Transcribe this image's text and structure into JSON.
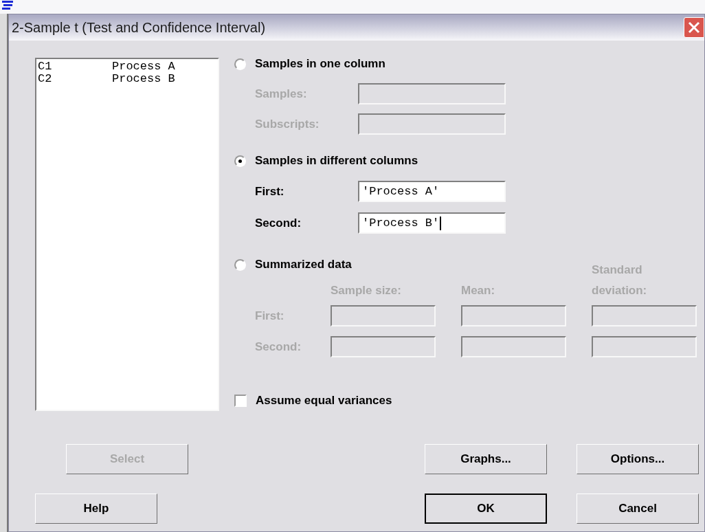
{
  "window": {
    "title": "2-Sample t (Test and Confidence Interval)"
  },
  "variables": [
    {
      "column": "C1",
      "name": "Process A"
    },
    {
      "column": "C2",
      "name": "Process B"
    }
  ],
  "modes": [
    {
      "kind": "fields",
      "label": "Samples in one column",
      "selected": false,
      "fields": [
        {
          "label": "Samples:",
          "disabled": true,
          "focused": false
        },
        {
          "label": "Subscripts:",
          "disabled": true,
          "focused": false
        }
      ]
    },
    {
      "kind": "fields",
      "label": "Samples in different columns",
      "selected": true,
      "fields": [
        {
          "label": "First:",
          "value": "'Process A'",
          "disabled": false,
          "focused": false
        },
        {
          "label": "Second:",
          "value": "'Process B'",
          "disabled": false,
          "focused": true
        }
      ]
    },
    {
      "kind": "grid",
      "label": "Summarized data",
      "selected": false,
      "disabled": true,
      "columns": [
        "Sample size:",
        "Mean:",
        "Standard deviation:"
      ],
      "rows": [
        {
          "label": "First:"
        },
        {
          "label": "Second:"
        }
      ]
    }
  ],
  "equal_variances": {
    "label": "Assume equal variances",
    "checked": false
  },
  "button_rows": [
    [
      {
        "label": "Select",
        "disabled": true,
        "default": false
      },
      {
        "label": "Graphs...",
        "disabled": false,
        "default": false
      },
      {
        "label": "Options...",
        "disabled": false,
        "default": false
      }
    ],
    [
      {
        "label": "Help",
        "disabled": false,
        "default": false
      },
      {
        "label": "OK",
        "disabled": false,
        "default": true
      },
      {
        "label": "Cancel",
        "disabled": false,
        "default": false
      }
    ]
  ]
}
